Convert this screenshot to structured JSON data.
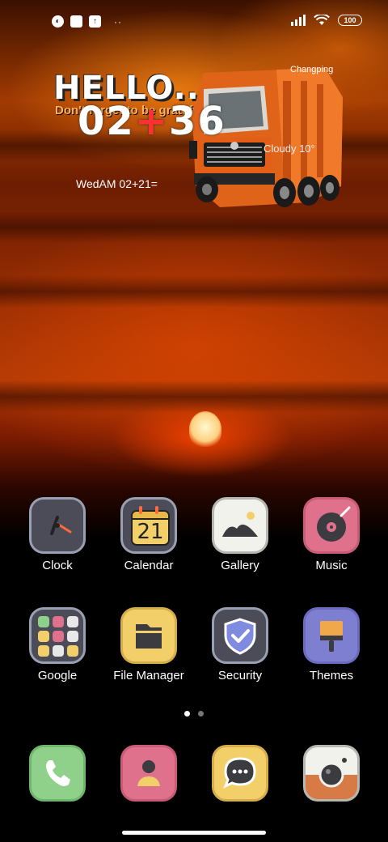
{
  "status_bar": {
    "notification_icons": [
      "weather-icon",
      "square-icon",
      "upload-icon"
    ],
    "more_indicator": "··",
    "battery_level": "100"
  },
  "widget": {
    "greeting": "HELLO...!",
    "reminder": "Don't forget to be grateful",
    "time_hours": "02",
    "time_separator": "+",
    "time_minutes": "36",
    "date_line": "WedAM 02+21=",
    "city": "Changping",
    "weather": "Cloudy 10°"
  },
  "apps": [
    {
      "label": "Clock",
      "icon": "clock-icon"
    },
    {
      "label": "Calendar",
      "icon": "calendar-icon",
      "day": "21"
    },
    {
      "label": "Gallery",
      "icon": "gallery-icon"
    },
    {
      "label": "Music",
      "icon": "music-icon"
    },
    {
      "label": "Google",
      "icon": "google-folder-icon"
    },
    {
      "label": "File Manager",
      "icon": "file-manager-icon"
    },
    {
      "label": "Security",
      "icon": "security-icon"
    },
    {
      "label": "Themes",
      "icon": "themes-icon"
    }
  ],
  "dock": [
    {
      "icon": "phone-icon"
    },
    {
      "icon": "contacts-icon"
    },
    {
      "icon": "messages-icon"
    },
    {
      "icon": "camera-icon"
    }
  ],
  "page_indicator": {
    "count": 2,
    "active": 1
  }
}
